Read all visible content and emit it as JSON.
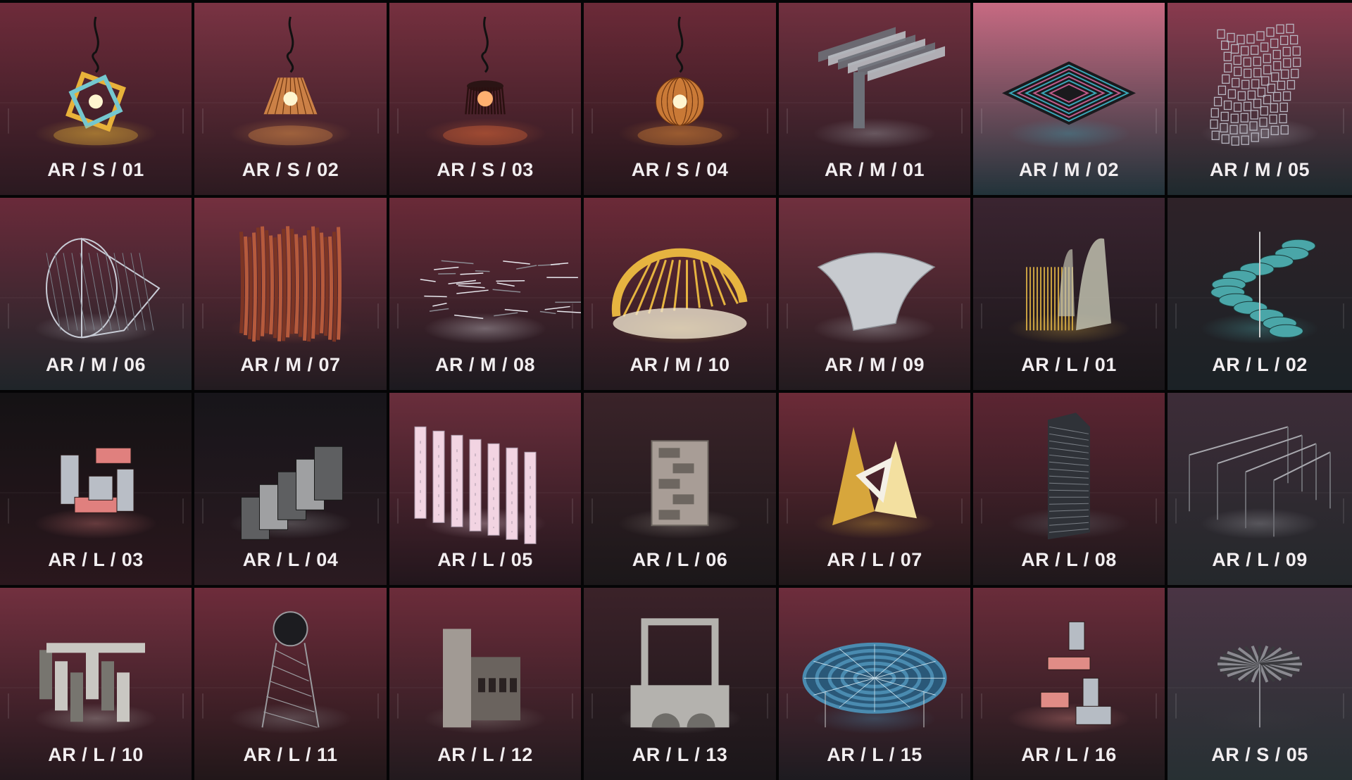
{
  "tiles": [
    {
      "label": "AR / S / 01",
      "type": "lamp",
      "variant": "cube",
      "palette": "warm",
      "accent": "#e8b23a",
      "accent2": "#74c7cf",
      "bgTop": "#6e2b3a",
      "bgBottom": "#2a1920"
    },
    {
      "label": "AR / S / 02",
      "type": "lamp",
      "variant": "cone",
      "palette": "warm",
      "accent": "#e0904a",
      "accent2": "#f7c070",
      "bgTop": "#7a3343",
      "bgBottom": "#2c1a20"
    },
    {
      "label": "AR / S / 03",
      "type": "lamp",
      "variant": "fringe",
      "palette": "warm",
      "accent": "#e26a3a",
      "accent2": "#ffb070",
      "bgTop": "#76303f",
      "bgBottom": "#2a181e"
    },
    {
      "label": "AR / S / 04",
      "type": "lamp",
      "variant": "sphere",
      "palette": "warm",
      "accent": "#e08a3a",
      "accent2": "#f7c070",
      "bgTop": "#6c2a38",
      "bgBottom": "#24161b"
    },
    {
      "label": "AR / M / 01",
      "type": "pipes",
      "variant": "",
      "palette": "metal",
      "accent": "#b9bcc2",
      "accent2": "#6d7078",
      "bgTop": "#71303f",
      "bgBottom": "#231a20"
    },
    {
      "label": "AR / M / 02",
      "type": "frame",
      "variant": "",
      "palette": "iridescent",
      "accent": "#3aa7b8",
      "accent2": "#c05b8a",
      "bgTop": "#c76a82",
      "bgBottom": "#22333a"
    },
    {
      "label": "AR / M / 05",
      "type": "mesh",
      "variant": "wave",
      "palette": "metal",
      "accent": "#b7b5c0",
      "accent2": "#6a6873",
      "bgTop": "#8a3a4e",
      "bgBottom": "#1e2a2e"
    },
    {
      "label": "AR / M / 06",
      "type": "mesh",
      "variant": "roll",
      "palette": "metal",
      "accent": "#c8ccd6",
      "accent2": "#7a7f88",
      "bgTop": "#6a2a3a",
      "bgBottom": "#1f2529"
    },
    {
      "label": "AR / M / 07",
      "type": "wall",
      "variant": "",
      "palette": "rust",
      "accent": "#b65a3c",
      "accent2": "#7c3524",
      "bgTop": "#74303f",
      "bgBottom": "#221b20"
    },
    {
      "label": "AR / M / 08",
      "type": "lines",
      "variant": "",
      "palette": "metal",
      "accent": "#e8e8ee",
      "accent2": "#8a8a92",
      "bgTop": "#6a2a38",
      "bgBottom": "#1c1a1f"
    },
    {
      "label": "AR / M / 10",
      "type": "dome",
      "variant": "",
      "palette": "gold",
      "accent": "#e6b440",
      "accent2": "#f0e6d0",
      "bgTop": "#6c2a38",
      "bgBottom": "#231a1f"
    },
    {
      "label": "AR / M / 09",
      "type": "shell",
      "variant": "",
      "palette": "metal",
      "accent": "#c7cacf",
      "accent2": "#8d9096",
      "bgTop": "#70303e",
      "bgBottom": "#221b1f"
    },
    {
      "label": "AR / L / 01",
      "type": "curves",
      "variant": "",
      "palette": "gold",
      "accent": "#c8a040",
      "accent2": "#bfbfae",
      "bgTop": "#3a2430",
      "bgBottom": "#191619"
    },
    {
      "label": "AR / L / 02",
      "type": "discs",
      "variant": "",
      "palette": "teal",
      "accent": "#4aa6a8",
      "accent2": "#d0d0d0",
      "bgTop": "#2e2228",
      "bgBottom": "#1b2226"
    },
    {
      "label": "AR / L / 03",
      "type": "blocks",
      "variant": "pink",
      "palette": "pink",
      "accent": "#e0807e",
      "accent2": "#b9bec6",
      "bgTop": "#141214",
      "bgBottom": "#2a171d"
    },
    {
      "label": "AR / L / 04",
      "type": "concrete",
      "variant": "stairs",
      "palette": "concrete",
      "accent": "#9fa0a2",
      "accent2": "#5e5f61",
      "bgTop": "#17151a",
      "bgBottom": "#2a1a20"
    },
    {
      "label": "AR / L / 05",
      "type": "slabs",
      "variant": "",
      "palette": "pink",
      "accent": "#f2d4e2",
      "accent2": "#a898a8",
      "bgTop": "#6a2e3c",
      "bgBottom": "#22161c"
    },
    {
      "label": "AR / L / 06",
      "type": "concrete",
      "variant": "tower",
      "palette": "concrete",
      "accent": "#a89d96",
      "accent2": "#6d6660",
      "bgTop": "#3a2329",
      "bgBottom": "#1b1719"
    },
    {
      "label": "AR / L / 07",
      "type": "crystal",
      "variant": "",
      "palette": "gold",
      "accent": "#d7a63c",
      "accent2": "#f3e0a0",
      "bgTop": "#6c2b38",
      "bgBottom": "#1f1719"
    },
    {
      "label": "AR / L / 08",
      "type": "skyscraper",
      "variant": "",
      "palette": "metal",
      "accent": "#7a7f86",
      "accent2": "#2f3238",
      "bgTop": "#5c2532",
      "bgBottom": "#1e181b"
    },
    {
      "label": "AR / L / 09",
      "type": "truss",
      "variant": "",
      "palette": "metal",
      "accent": "#a8a8ae",
      "accent2": "#6a6a70",
      "bgTop": "#3d2c38",
      "bgBottom": "#24282b"
    },
    {
      "label": "AR / L / 10",
      "type": "concrete",
      "variant": "maze",
      "palette": "concrete",
      "accent": "#c9c7c2",
      "accent2": "#77756f",
      "bgTop": "#72303f",
      "bgBottom": "#24181d"
    },
    {
      "label": "AR / L / 11",
      "type": "watertower",
      "variant": "",
      "palette": "metal",
      "accent": "#9a9a9e",
      "accent2": "#3a3a3e",
      "bgTop": "#6e2c3b",
      "bgBottom": "#211719"
    },
    {
      "label": "AR / L / 12",
      "type": "concrete",
      "variant": "walls",
      "palette": "concrete",
      "accent": "#a19a94",
      "accent2": "#6a635e",
      "bgTop": "#6c2c3a",
      "bgBottom": "#221a1e"
    },
    {
      "label": "AR / L / 13",
      "type": "concrete",
      "variant": "arches",
      "palette": "concrete",
      "accent": "#b4b2ae",
      "accent2": "#6f6d69",
      "bgTop": "#3b2229",
      "bgBottom": "#1a1619"
    },
    {
      "label": "AR / L / 15",
      "type": "canopy",
      "variant": "",
      "palette": "blue",
      "accent": "#4a8bb0",
      "accent2": "#2a5878",
      "bgTop": "#6e2d3c",
      "bgBottom": "#1d1b20"
    },
    {
      "label": "AR / L / 16",
      "type": "blocks",
      "variant": "pinktall",
      "palette": "pink",
      "accent": "#e08c86",
      "accent2": "#b6bcc4",
      "bgTop": "#6a2c3a",
      "bgBottom": "#1f191c"
    },
    {
      "label": "AR / S / 05",
      "type": "fan",
      "variant": "",
      "palette": "metal",
      "accent": "#3a3a3e",
      "accent2": "#8a8a90",
      "bgTop": "#4a3444",
      "bgBottom": "#273033"
    }
  ]
}
